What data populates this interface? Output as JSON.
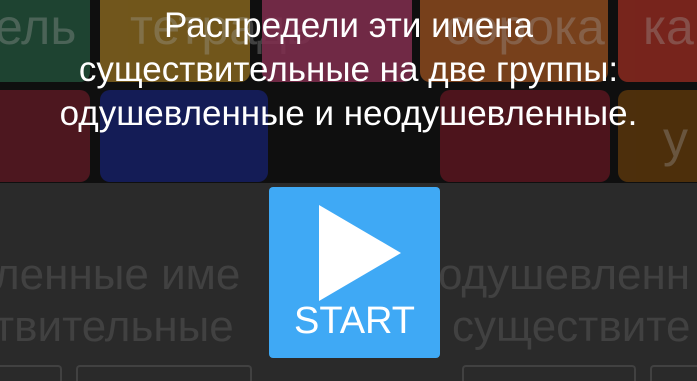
{
  "instruction": {
    "line1": "Распредели эти имена",
    "line2": "существительные на две группы:",
    "line3": "одушевленные и неодушевленные."
  },
  "start_button": {
    "label": "START"
  },
  "background": {
    "tiles": [
      {
        "text": "ель",
        "color": "#2e6b4d"
      },
      {
        "text": "тетрадь",
        "color": "#b58a2a"
      },
      {
        "text": "",
        "color": "#b3406d"
      },
      {
        "text": "сорока",
        "color": "#c0652a"
      },
      {
        "text": "ка",
        "color": "#c0392b"
      },
      {
        "text": "",
        "color": "#7a2330"
      },
      {
        "text": "",
        "color": "#1f2a8a"
      },
      {
        "text": "",
        "color": "#7a1f2b"
      },
      {
        "text": "у",
        "color": "#7a4a10"
      }
    ],
    "group_left_line1": "ленные име",
    "group_left_line2": "твительные",
    "group_right_line1": "одушевленн",
    "group_right_line2": "существите"
  },
  "colors": {
    "start_bg": "#3fa9f5",
    "overlay_text": "#ffffff"
  }
}
